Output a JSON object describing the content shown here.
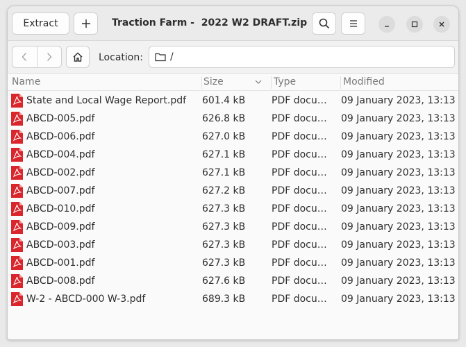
{
  "header": {
    "extract_label": "Extract",
    "title": "Traction Farm -  2022 W2 DRAFT.zip"
  },
  "toolbar": {
    "location_label": "Location:",
    "path": "/"
  },
  "columns": {
    "name": "Name",
    "size": "Size",
    "type": "Type",
    "modified": "Modified"
  },
  "files": [
    {
      "name": "State and Local Wage Report.pdf",
      "size": "601.4 kB",
      "type": "PDF document",
      "modified": "09 January 2023, 13:13"
    },
    {
      "name": "ABCD-005.pdf",
      "size": "626.8 kB",
      "type": "PDF document",
      "modified": "09 January 2023, 13:13"
    },
    {
      "name": "ABCD-006.pdf",
      "size": "627.0 kB",
      "type": "PDF document",
      "modified": "09 January 2023, 13:13"
    },
    {
      "name": "ABCD-004.pdf",
      "size": "627.1 kB",
      "type": "PDF document",
      "modified": "09 January 2023, 13:13"
    },
    {
      "name": "ABCD-002.pdf",
      "size": "627.1 kB",
      "type": "PDF document",
      "modified": "09 January 2023, 13:13"
    },
    {
      "name": "ABCD-007.pdf",
      "size": "627.2 kB",
      "type": "PDF document",
      "modified": "09 January 2023, 13:13"
    },
    {
      "name": "ABCD-010.pdf",
      "size": "627.3 kB",
      "type": "PDF document",
      "modified": "09 January 2023, 13:13"
    },
    {
      "name": "ABCD-009.pdf",
      "size": "627.3 kB",
      "type": "PDF document",
      "modified": "09 January 2023, 13:13"
    },
    {
      "name": "ABCD-003.pdf",
      "size": "627.3 kB",
      "type": "PDF document",
      "modified": "09 January 2023, 13:13"
    },
    {
      "name": "ABCD-001.pdf",
      "size": "627.3 kB",
      "type": "PDF document",
      "modified": "09 January 2023, 13:13"
    },
    {
      "name": "ABCD-008.pdf",
      "size": "627.6 kB",
      "type": "PDF document",
      "modified": "09 January 2023, 13:13"
    },
    {
      "name": "W-2 - ABCD-000 W-3.pdf",
      "size": "689.3 kB",
      "type": "PDF document",
      "modified": "09 January 2023, 13:13"
    }
  ],
  "icons": {
    "file": "pdf-file-icon",
    "pdf_color": "#d9262c"
  }
}
